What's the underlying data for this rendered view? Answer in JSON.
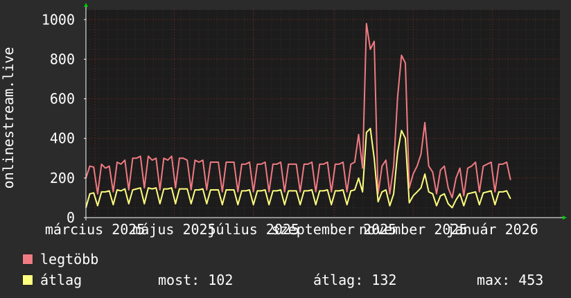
{
  "chart_data": {
    "type": "line",
    "ylabel": "onlinestream.live",
    "ylim": [
      0,
      1050
    ],
    "yticks": [
      0,
      200,
      400,
      600,
      800,
      1000
    ],
    "x_tick_labels": [
      "március 2025",
      "május 2025",
      "július 2025",
      "szeptember 2025",
      "november 2025",
      "január 2026"
    ],
    "x_range": [
      "2025-02-22",
      "2026-02-22"
    ],
    "x_tick_dates": [
      "2025-03-01",
      "2025-05-01",
      "2025-07-01",
      "2025-09-01",
      "2025-11-01",
      "2026-01-01"
    ],
    "series": [
      {
        "name": "legtöbb",
        "color": "#f07b82",
        "x_start": "2025-02-22",
        "x_step_days": 3,
        "values": [
          200,
          260,
          255,
          120,
          270,
          250,
          260,
          130,
          280,
          270,
          290,
          140,
          300,
          300,
          310,
          150,
          310,
          290,
          300,
          140,
          300,
          290,
          310,
          150,
          300,
          300,
          290,
          140,
          290,
          280,
          290,
          140,
          280,
          280,
          280,
          130,
          280,
          280,
          280,
          130,
          270,
          270,
          280,
          130,
          270,
          270,
          280,
          130,
          270,
          270,
          280,
          130,
          270,
          270,
          270,
          130,
          270,
          270,
          280,
          130,
          270,
          270,
          280,
          130,
          270,
          270,
          280,
          130,
          270,
          280,
          420,
          250,
          980,
          850,
          890,
          120,
          260,
          290,
          120,
          260,
          610,
          820,
          780,
          150,
          220,
          260,
          320,
          480,
          260,
          230,
          120,
          240,
          260,
          150,
          100,
          200,
          250,
          110,
          250,
          260,
          280,
          130,
          260,
          270,
          280,
          130,
          270,
          270,
          280,
          190
        ]
      },
      {
        "name": "átlag",
        "color": "#ffff7f",
        "x_start": "2025-02-22",
        "x_step_days": 3,
        "values": [
          50,
          120,
          125,
          60,
          130,
          130,
          135,
          65,
          140,
          135,
          145,
          70,
          140,
          145,
          150,
          70,
          150,
          145,
          150,
          70,
          145,
          145,
          150,
          70,
          145,
          145,
          145,
          70,
          140,
          140,
          145,
          70,
          140,
          140,
          140,
          65,
          140,
          140,
          140,
          65,
          135,
          135,
          140,
          65,
          135,
          135,
          140,
          65,
          135,
          135,
          140,
          65,
          135,
          135,
          135,
          65,
          135,
          135,
          140,
          65,
          135,
          135,
          140,
          65,
          135,
          135,
          140,
          65,
          135,
          140,
          200,
          130,
          430,
          450,
          300,
          80,
          130,
          140,
          60,
          120,
          330,
          440,
          400,
          75,
          110,
          130,
          150,
          220,
          130,
          120,
          60,
          110,
          120,
          70,
          50,
          90,
          120,
          60,
          120,
          125,
          130,
          65,
          125,
          130,
          135,
          65,
          130,
          130,
          135,
          95
        ]
      }
    ],
    "legend": [
      {
        "name": "legtöbb"
      },
      {
        "name": "átlag"
      }
    ],
    "stats": {
      "now_label": "most:",
      "now_value": "102",
      "avg_label": "átlag:",
      "avg_value": "132",
      "max_label": "max:",
      "max_value": "453"
    },
    "grid": true,
    "colors": {
      "background": "#2b2b2b",
      "plot": "#1c1c1c",
      "grid_major": "#5a2424",
      "grid_minor": "#3c2a2a",
      "axis": "#ffffff",
      "arrow": "#00cc00"
    }
  }
}
